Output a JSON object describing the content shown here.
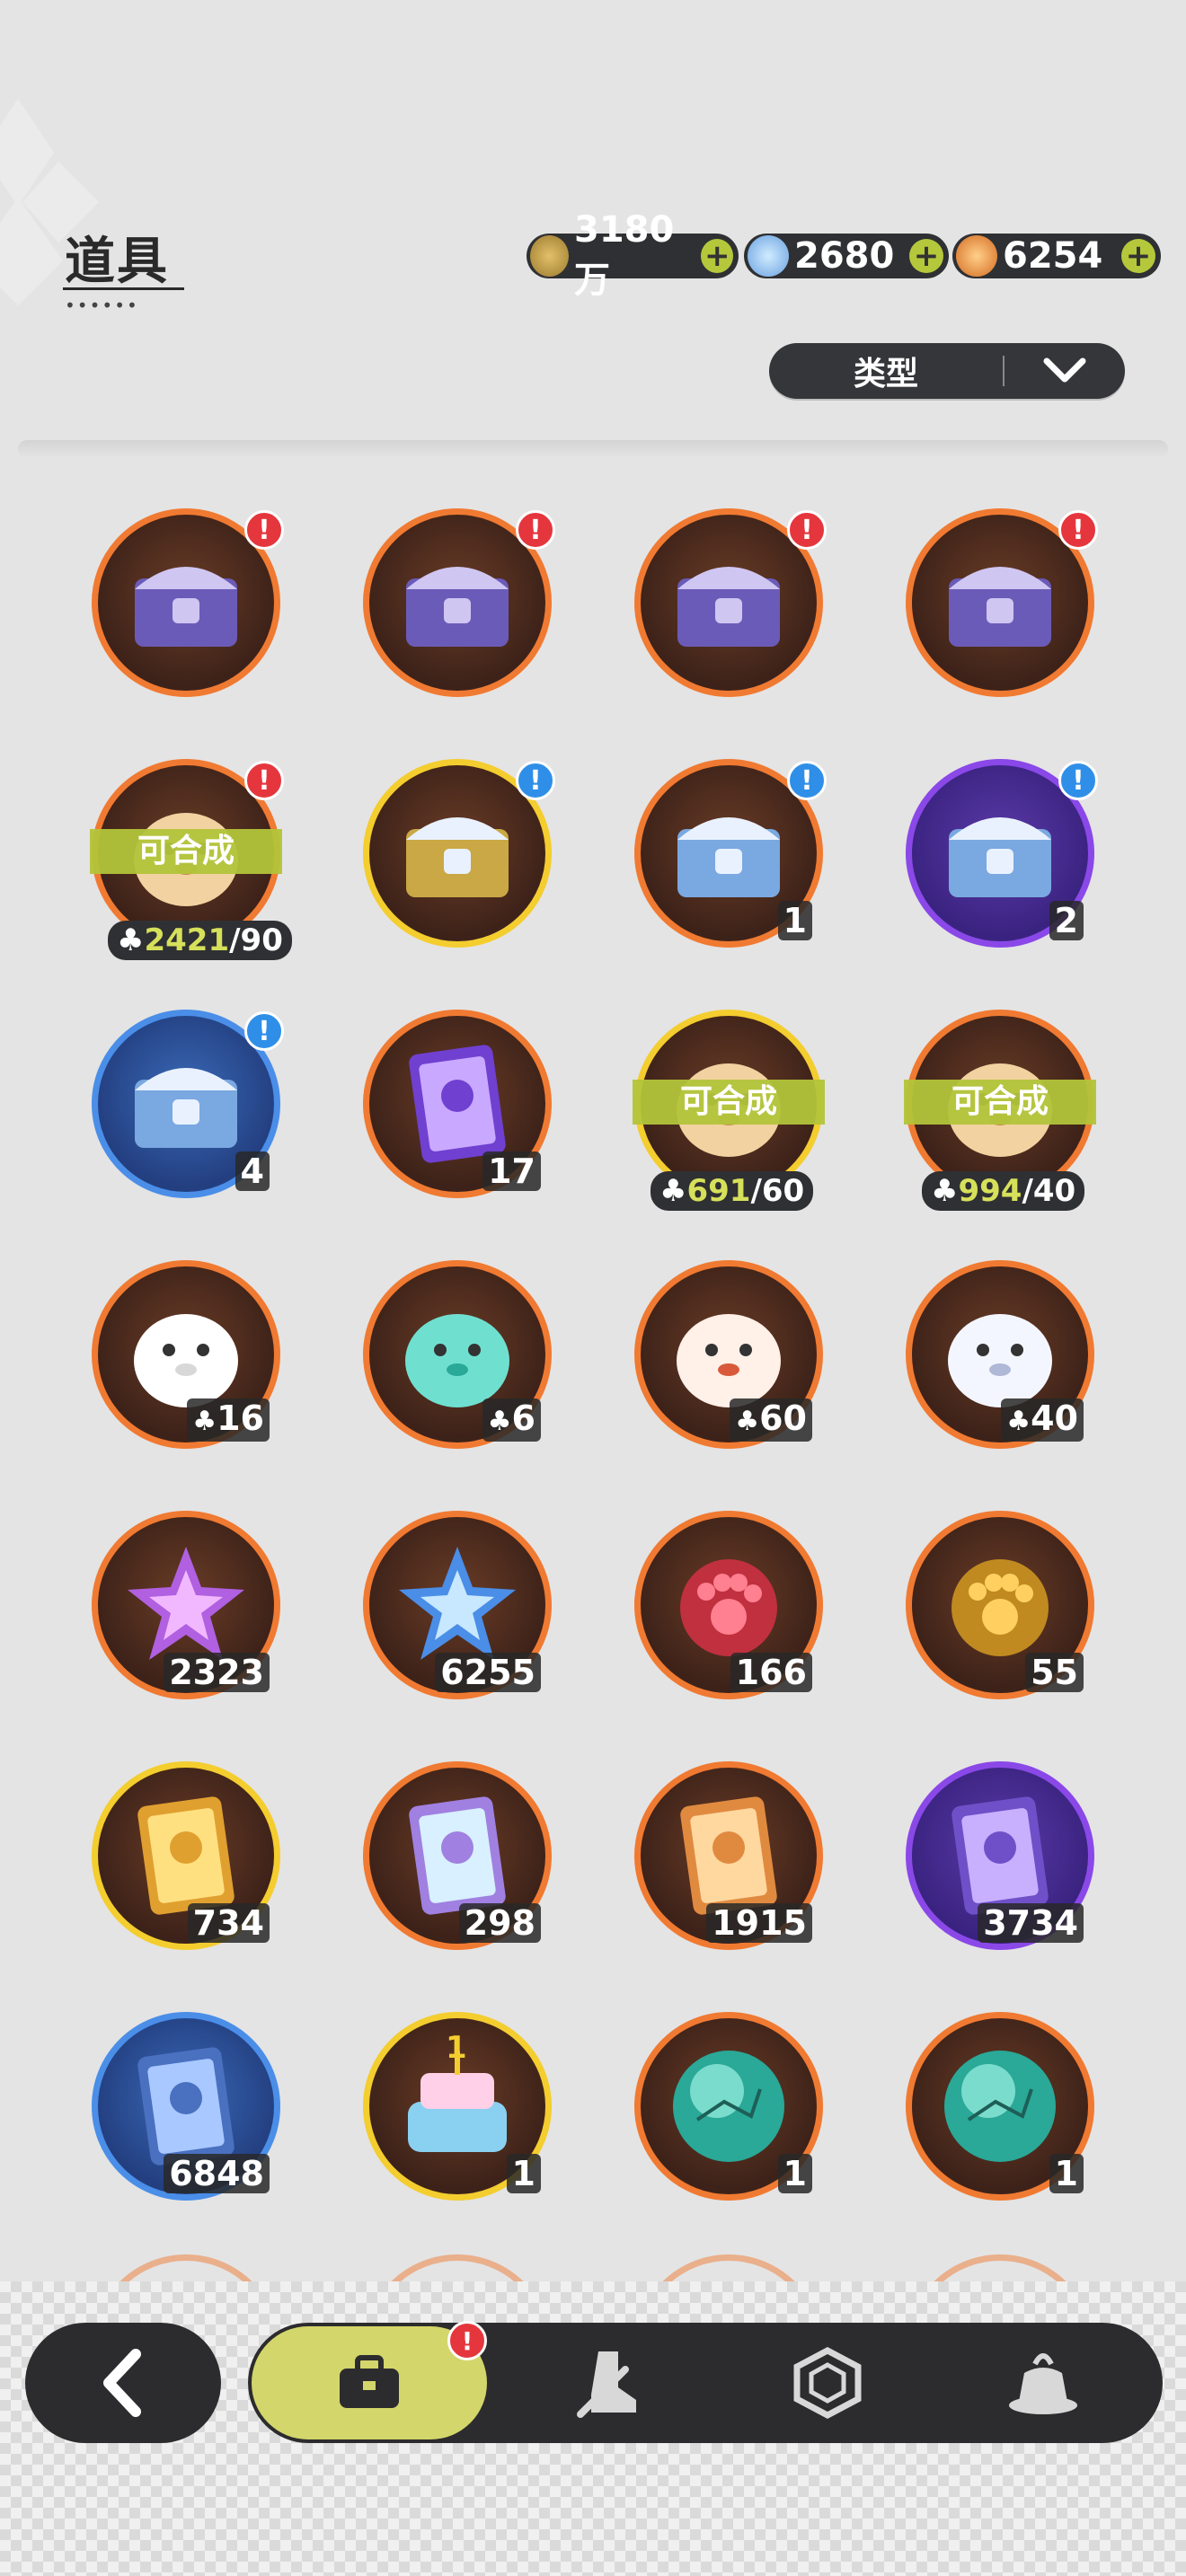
{
  "header": {
    "title": "道具",
    "currencies": [
      {
        "name": "coin",
        "value": "3180万",
        "icon": "gold-coin-icon",
        "color": "#c9a045"
      },
      {
        "name": "crystal",
        "value": "2680",
        "icon": "crystal-icon",
        "color": "#7ab8f0"
      },
      {
        "name": "star",
        "value": "6254",
        "icon": "star-shard-icon",
        "color": "#f08a3a"
      }
    ],
    "plus_label": "+",
    "filter_label": "类型"
  },
  "items": [
    {
      "icon": "mystery-chest-icon",
      "ring": "orange",
      "alert": "red"
    },
    {
      "icon": "mystery-chest-icon",
      "ring": "orange",
      "alert": "red"
    },
    {
      "icon": "mystery-chest-icon",
      "ring": "orange",
      "alert": "red"
    },
    {
      "icon": "mystery-chest-icon",
      "ring": "orange",
      "alert": "red"
    },
    {
      "icon": "hamster-fragment-icon",
      "ring": "orange",
      "alert": "red",
      "synth": "可合成",
      "have": "2421",
      "need": "/90"
    },
    {
      "icon": "gold-chest-icon",
      "ring": "gold",
      "alert": "blue"
    },
    {
      "icon": "selection-chest-icon",
      "ring": "orange",
      "alert": "blue",
      "count": "1"
    },
    {
      "icon": "selection-chest-icon",
      "ring": "purple",
      "alert": "blue",
      "count": "2"
    },
    {
      "icon": "selection-chest-icon",
      "ring": "blue",
      "alert": "blue",
      "count": "4"
    },
    {
      "icon": "purple-crystal-card-icon",
      "ring": "orange",
      "count": "17"
    },
    {
      "icon": "hamster-fragment-icon",
      "ring": "gold",
      "synth": "可合成",
      "have": "691",
      "need": "/60"
    },
    {
      "icon": "hamster-fragment-icon",
      "ring": "orange",
      "synth": "可合成",
      "have": "994",
      "need": "/40"
    },
    {
      "icon": "white-bird-fragment-icon",
      "ring": "orange",
      "count": "16",
      "fragment": true
    },
    {
      "icon": "teal-bird-fragment-icon",
      "ring": "orange",
      "count": "6",
      "fragment": true
    },
    {
      "icon": "fox-mask-fragment-icon",
      "ring": "orange",
      "count": "60",
      "fragment": true
    },
    {
      "icon": "white-cat-fragment-icon",
      "ring": "orange",
      "count": "40",
      "fragment": true
    },
    {
      "icon": "pink-star-crystal-icon",
      "ring": "orange",
      "count": "2323"
    },
    {
      "icon": "blue-star-crystal-icon",
      "ring": "orange",
      "count": "6255"
    },
    {
      "icon": "pink-paw-bell-icon",
      "ring": "orange",
      "count": "166"
    },
    {
      "icon": "gold-paw-bell-icon",
      "ring": "orange",
      "count": "55"
    },
    {
      "icon": "gold-character-card-icon",
      "ring": "gold",
      "count": "734"
    },
    {
      "icon": "rainbow-character-card-icon",
      "ring": "orange",
      "count": "298"
    },
    {
      "icon": "orange-character-card-icon",
      "ring": "orange",
      "count": "1915"
    },
    {
      "icon": "purple-character-card-icon",
      "ring": "purple",
      "count": "3734"
    },
    {
      "icon": "blue-character-card-icon",
      "ring": "blue",
      "count": "6848"
    },
    {
      "icon": "birthday-cake-icon",
      "ring": "gold",
      "count": "1",
      "topnum": "1"
    },
    {
      "icon": "teal-orb-icon",
      "ring": "orange",
      "count": "1"
    },
    {
      "icon": "teal-orb-icon",
      "ring": "orange",
      "count": "1"
    }
  ],
  "tabs": [
    {
      "icon": "backpack-icon",
      "active": true,
      "alert": "!"
    },
    {
      "icon": "boot-sword-icon"
    },
    {
      "icon": "hexagon-gem-icon"
    },
    {
      "icon": "pudding-icon"
    }
  ],
  "alert_mark": "!"
}
